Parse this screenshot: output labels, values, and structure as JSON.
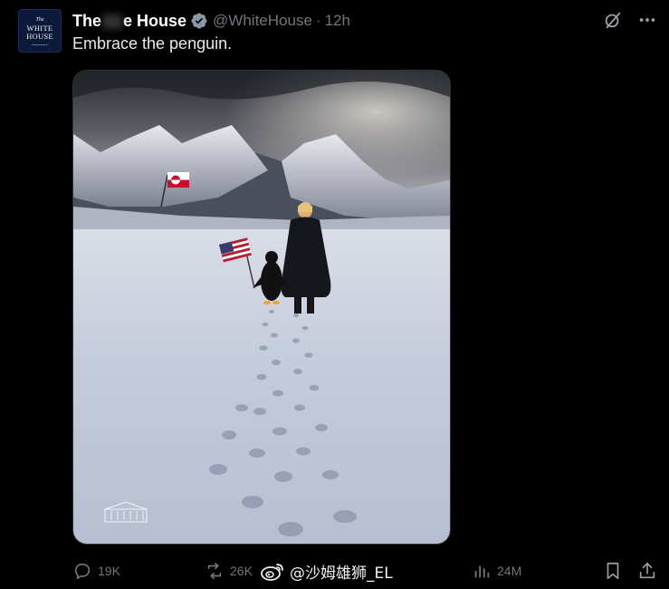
{
  "account": {
    "avatar_lines": [
      "The",
      "WHITE",
      "HOUSE"
    ],
    "display_name_start": "The",
    "display_name_end": "e House",
    "handle": "@WhiteHouse",
    "separator": "·",
    "time": "12h",
    "verified_color": "#8b98a5"
  },
  "tweet": {
    "text": "Embrace the penguin."
  },
  "media": {
    "alt": "A man and a penguin walking across snow toward mountains, with footprints trailing behind; a US flag near the penguin and a Greenland flag planted on the mountain slope.",
    "icon_names": [
      "usa-flag",
      "greenland-flag",
      "white-house-watermark"
    ]
  },
  "stats": {
    "replies": "19K",
    "reposts": "26K",
    "views": "24M"
  },
  "overlay": {
    "watermark_text": "@沙姆雄狮_EL"
  },
  "colors": {
    "background": "#000000",
    "secondary_text": "#71767b",
    "primary_text": "#e7e9ea"
  }
}
